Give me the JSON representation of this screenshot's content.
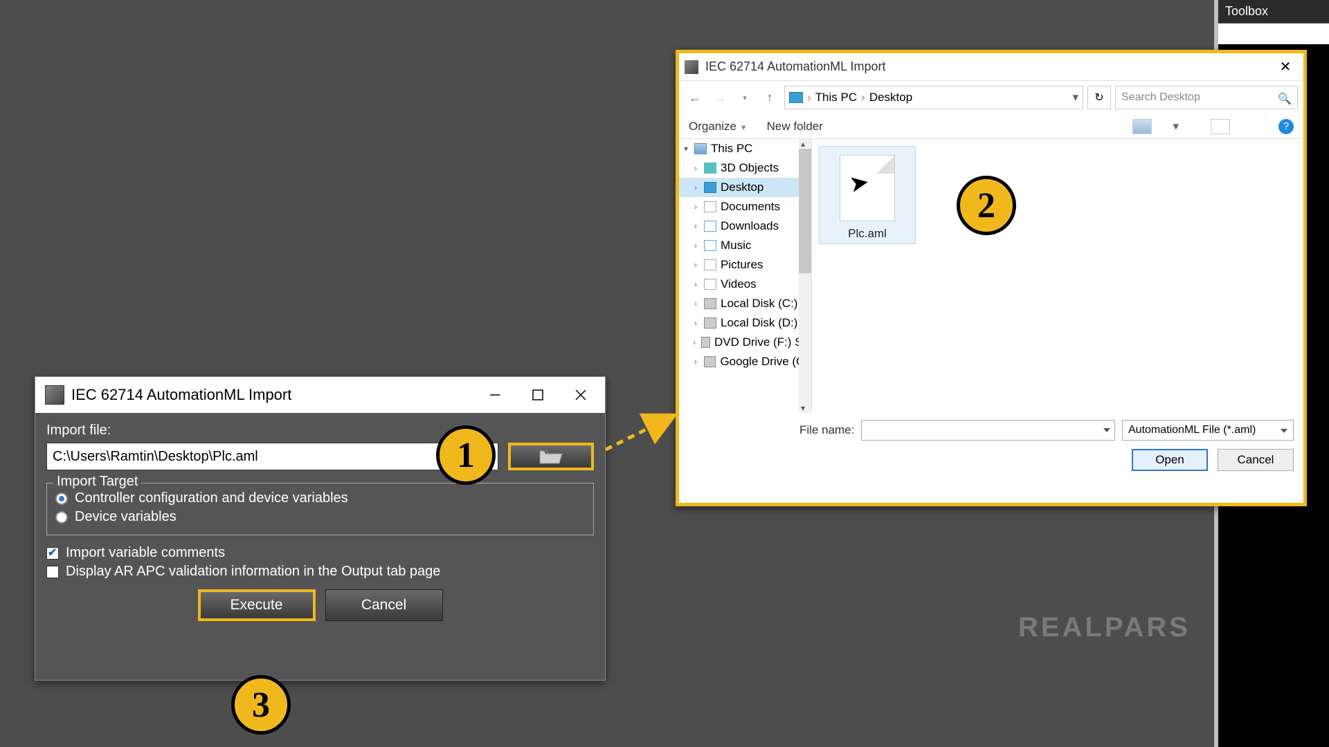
{
  "toolbox": {
    "title": "Toolbox"
  },
  "importDialog": {
    "title": "IEC 62714 AutomationML Import",
    "label_importFile": "Import file:",
    "importFileValue": "C:\\Users\\Ramtin\\Desktop\\Plc.aml",
    "legend_target": "Import Target",
    "radio1": "Controller configuration and device variables",
    "radio2": "Device variables",
    "check1": "Import variable comments",
    "check2": "Display AR APC validation information in the Output tab page",
    "btn_execute": "Execute",
    "btn_cancel": "Cancel"
  },
  "fileDialog": {
    "title": "IEC 62714 AutomationML Import",
    "crumb1": "This PC",
    "crumb2": "Desktop",
    "searchPlaceholder": "Search Desktop",
    "organize": "Organize",
    "newFolder": "New folder",
    "tree": {
      "thispc": "This PC",
      "items": [
        "3D Objects",
        "Desktop",
        "Documents",
        "Downloads",
        "Music",
        "Pictures",
        "Videos",
        "Local Disk (C:)",
        "Local Disk (D:)",
        "DVD Drive (F:) Sy",
        "Google Drive (G:"
      ]
    },
    "file": "Plc.aml",
    "filenameLabel": "File name:",
    "filter": "AutomationML File (*.aml)",
    "btn_open": "Open",
    "btn_cancel": "Cancel"
  },
  "badges": {
    "b1": "1",
    "b2": "2",
    "b3": "3"
  },
  "watermark": "REALPARS"
}
